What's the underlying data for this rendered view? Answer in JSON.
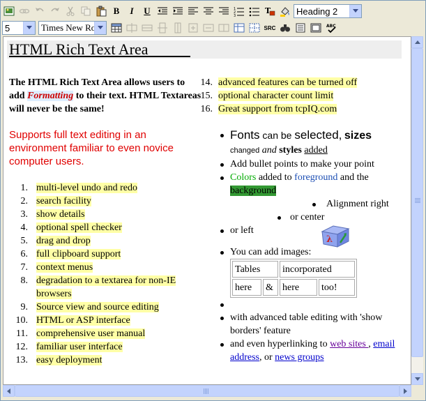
{
  "toolbar": {
    "heading_select": "Heading 2",
    "size_select": "5",
    "font_select": "Times New Roman",
    "src_label": "SRC"
  },
  "editor": {
    "title": "HTML Rich Text Area",
    "intro_a": "The HTML Rich Text Area allows users to add ",
    "intro_formatting": "Formatting",
    "intro_b": " to their text. HTML Textareas will never be the same!",
    "support": "Supports full text editing in an environment familiar to even novice computer users.",
    "features": [
      {
        "num": "1.",
        "text": "multi-level undo and redo"
      },
      {
        "num": "2.",
        "text": "search facility"
      },
      {
        "num": "3.",
        "text": "show details"
      },
      {
        "num": "4.",
        "text": "optional spell checker"
      },
      {
        "num": "5.",
        "text": "drag and drop"
      },
      {
        "num": "6.",
        "text": "full clipboard support"
      },
      {
        "num": "7.",
        "text": "context menus"
      },
      {
        "num": "8.",
        "text": "degradation to a textarea for non-IE browsers"
      },
      {
        "num": "9.",
        "text": "Source view and source editing"
      },
      {
        "num": "10.",
        "text": "HTML or ASP interface"
      },
      {
        "num": "11.",
        "text": "comprehensive user manual"
      },
      {
        "num": "12.",
        "text": "familiar user interface"
      },
      {
        "num": "13.",
        "text": "easy deployment"
      },
      {
        "num": "14.",
        "text": "advanced features can be turned off"
      },
      {
        "num": "15.",
        "text": "optional character count limit"
      },
      {
        "num": "16.",
        "text": "Great support from tcpIQ.com"
      }
    ],
    "bullets": {
      "fonts_a": "Fonts",
      "fonts_b": " can be ",
      "fonts_c": "selected,",
      "fonts_d": "sizes",
      "fonts_e": "changed",
      "fonts_f": "and",
      "fonts_g": "styles",
      "fonts_h": "added",
      "bullets_text": "Add bullet points to make your point",
      "colors_a": "Colors",
      "colors_b": " added to ",
      "colors_c": "foreground",
      "colors_d": " and the ",
      "colors_e": "background",
      "align_right": "Alignment right",
      "align_center": "or center",
      "align_left": "or left",
      "images": "You can add images:",
      "table": [
        [
          "Tables",
          "incorporated"
        ],
        [
          "here",
          "&",
          "here",
          "too!"
        ]
      ],
      "tables_text": "with advanced table editing with 'show borders' feature",
      "links_a": "and even hyperlinking to ",
      "link_web": "web sites ",
      "links_b": ", ",
      "link_email": "email address",
      "links_c": ", or ",
      "link_news": "news groups"
    }
  }
}
